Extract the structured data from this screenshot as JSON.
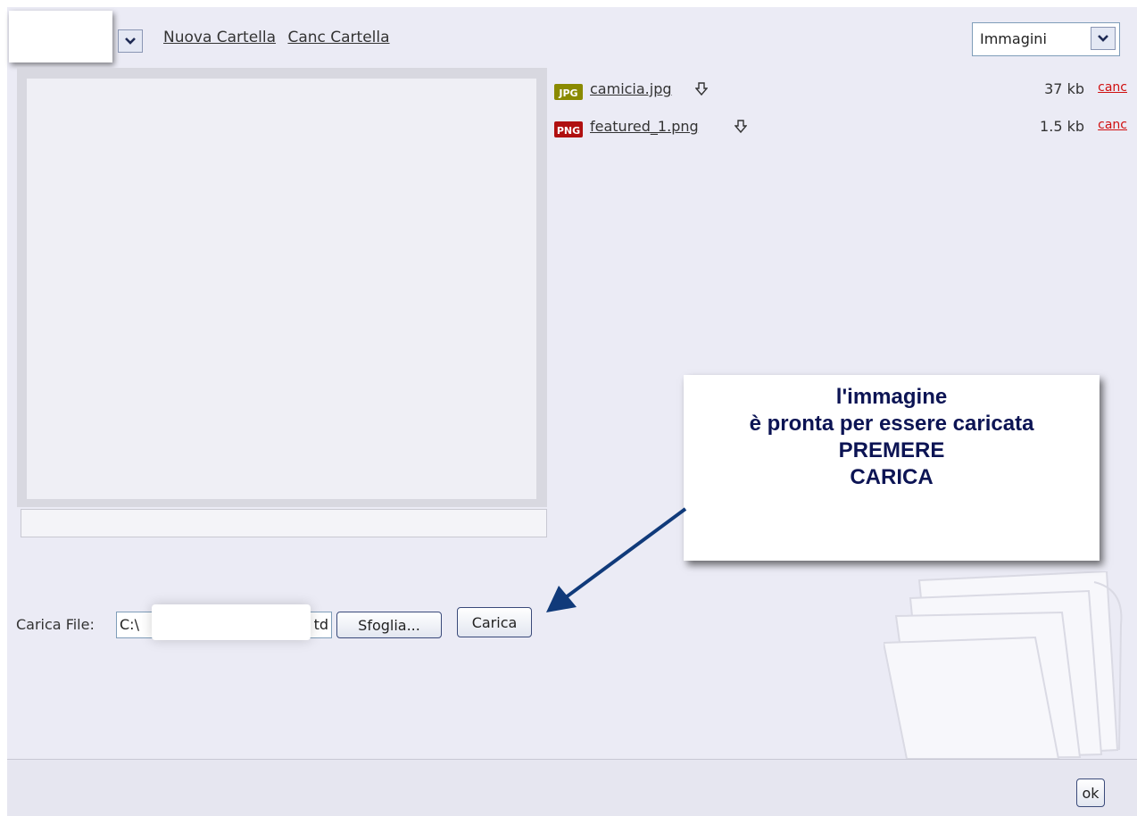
{
  "toolbar": {
    "new_folder": "Nuova Cartella",
    "delete_folder": "Canc Cartella",
    "filter_value": "Immagini"
  },
  "files": [
    {
      "icon": "jpg-file-icon",
      "icon_text": "JPG",
      "icon_color": "#8a8a00",
      "name": "camicia.jpg",
      "size": "37 kb",
      "delete": "canc"
    },
    {
      "icon": "png-file-icon",
      "icon_text": "PNG",
      "icon_color": "#b01010",
      "name": "featured_1.png",
      "size": "1.5 kb",
      "delete": "canc"
    }
  ],
  "callout": {
    "lines": [
      "l'immagine",
      "è pronta per essere caricata",
      "PREMERE",
      "CARICA"
    ]
  },
  "upload": {
    "label": "Carica File:",
    "path_start": "C:\\",
    "path_end": "td",
    "browse": "Sfoglia...",
    "submit": "Carica"
  },
  "footer": {
    "ok": "ok"
  },
  "colors": {
    "accent": "#0c1454",
    "link_delete": "#d01010",
    "arrow": "#103a7a"
  }
}
